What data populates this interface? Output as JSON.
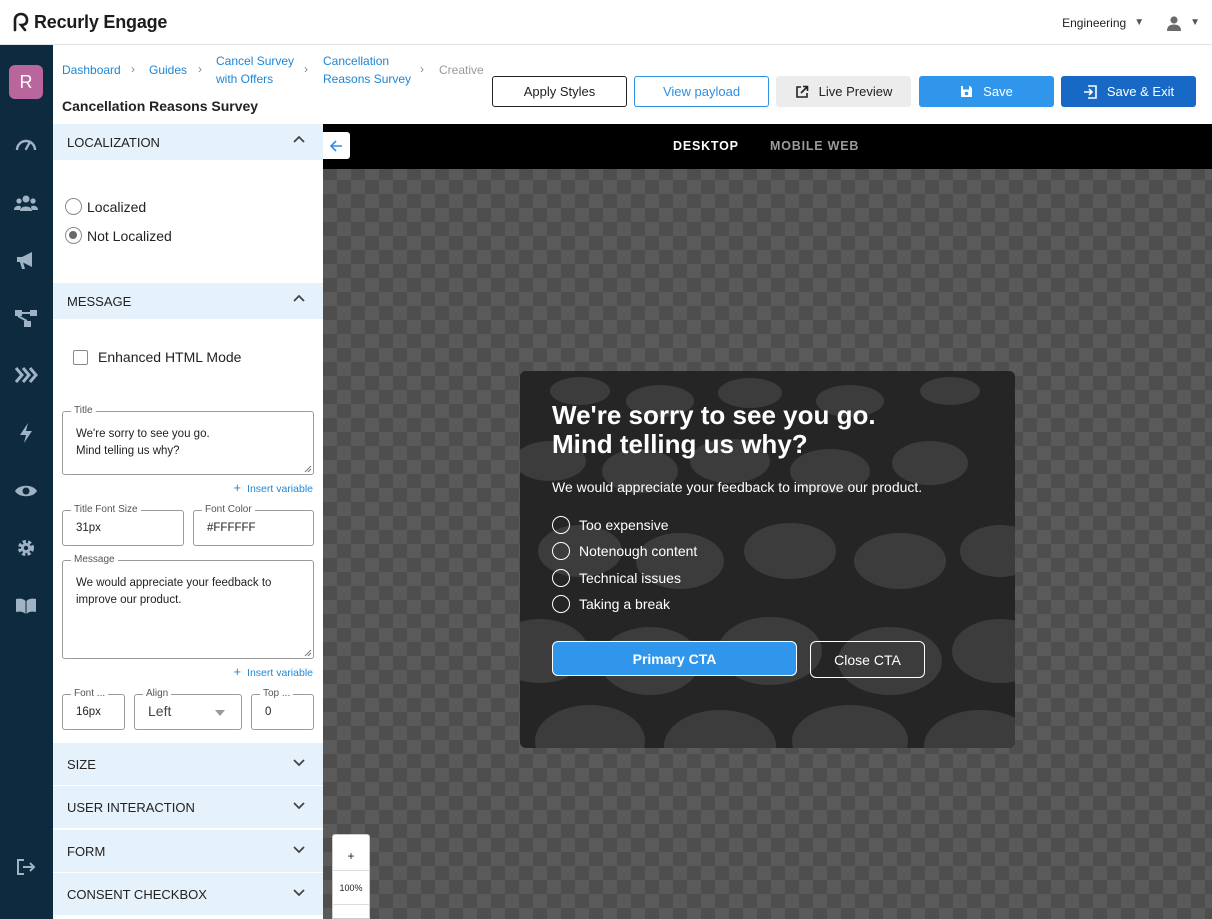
{
  "app": {
    "title": "Recurly Engage"
  },
  "header": {
    "workspace": "Engineering"
  },
  "nav": {
    "avatar_letter": "R"
  },
  "breadcrumbs": [
    {
      "line1": "Dashboard",
      "line2": ""
    },
    {
      "line1": "Guides",
      "line2": ""
    },
    {
      "line1": "Cancel Survey",
      "line2": "with Offers"
    },
    {
      "line1": "Cancellation",
      "line2": "Reasons Survey"
    },
    {
      "line1": "Creative",
      "line2": ""
    }
  ],
  "page_title": "Cancellation Reasons Survey",
  "toolbar": {
    "apply_styles": "Apply Styles",
    "view_payload": "View payload",
    "live_preview": "Live Preview",
    "save": "Save",
    "save_exit": "Save & Exit"
  },
  "panel": {
    "localization": {
      "heading": "LOCALIZATION",
      "options": [
        "Localized",
        "Not Localized"
      ],
      "selected": "Not Localized"
    },
    "message": {
      "heading": "MESSAGE",
      "enhanced_html": "Enhanced HTML Mode",
      "enhanced_html_checked": false,
      "title_label": "Title",
      "title_value": "We're sorry to see you go.\nMind telling us why?",
      "insert_variable": "Insert variable",
      "title_font_size_label": "Title Font Size",
      "title_font_size": "31px",
      "font_color_label": "Font Color",
      "font_color": "#FFFFFF",
      "message_label": "Message",
      "message_value": "We would appreciate your feedback to\nimprove our product.",
      "font_label": "Font ...",
      "font_value": "16px",
      "align_label": "Align",
      "align_value": "Left",
      "top_label": "Top ...",
      "top_value": "0"
    },
    "collapsed_sections": [
      "SIZE",
      "USER INTERACTION",
      "FORM",
      "CONSENT CHECKBOX"
    ]
  },
  "preview": {
    "tabs": [
      "DESKTOP",
      "MOBILE WEB"
    ],
    "active_tab": "DESKTOP",
    "title": "We're sorry to see you go.\nMind telling us why?",
    "message": "We would appreciate your feedback to improve our product.",
    "options": [
      "Too expensive",
      "Notenough content",
      "Technical issues",
      "Taking a break"
    ],
    "primary_cta": "Primary CTA",
    "close_cta": "Close CTA",
    "zoom_in": "+",
    "zoom_level": "100%"
  },
  "colors": {
    "nav_bg": "#0e2a3f",
    "accent": "#2f96ec",
    "save_exit": "#1769c5",
    "avatar": "#b9669c",
    "section_bg": "#e5f1fb"
  }
}
